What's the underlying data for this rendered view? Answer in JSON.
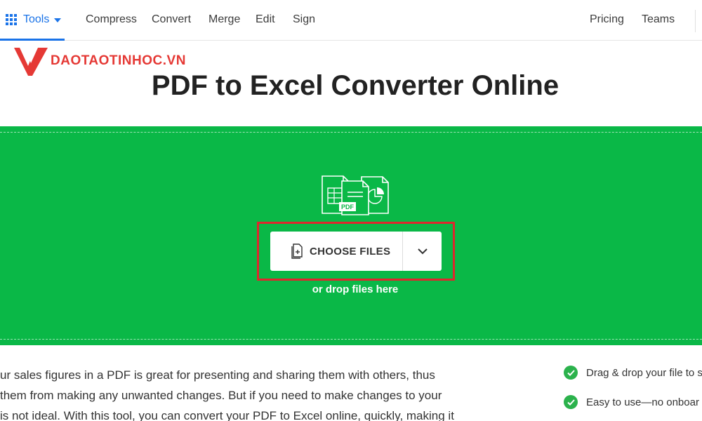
{
  "nav": {
    "tools_label": "Tools",
    "links": [
      "Compress",
      "Convert",
      "Merge",
      "Edit",
      "Sign"
    ],
    "right_links": [
      "Pricing",
      "Teams"
    ]
  },
  "logo": {
    "text": "DAOTAOTINHOC.VN"
  },
  "page": {
    "title": "PDF to Excel Converter Online"
  },
  "upload": {
    "choose_label": "CHOOSE FILES",
    "drop_hint": "or drop files here",
    "icon_badge": "PDF"
  },
  "description": {
    "lines": [
      "ur sales figures in a PDF is great for presenting and sharing them with others, thus",
      "them from making any unwanted changes. But if you need to make changes to your",
      "is not ideal. With this tool, you can convert your PDF to Excel online, quickly, making it"
    ]
  },
  "features": [
    "Drag & drop your file to s",
    "Easy to use—no onboar"
  ],
  "colors": {
    "accent": "#1a73e8",
    "drop_zone": "#0ab847",
    "highlight": "#e0262d",
    "logo": "#e53935",
    "check": "#2bb24c"
  }
}
